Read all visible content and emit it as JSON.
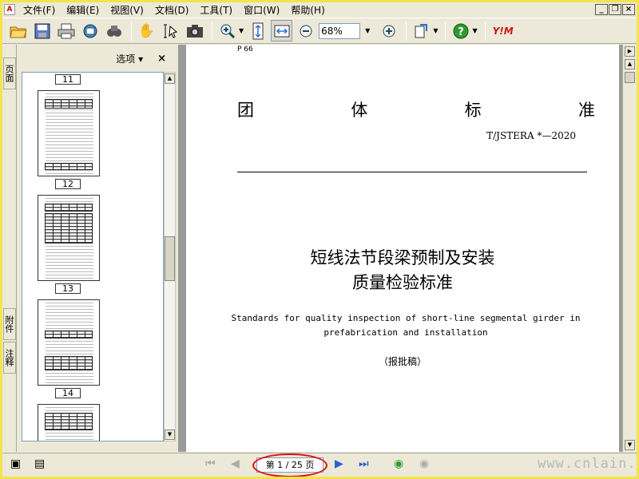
{
  "menubar": {
    "items": [
      "文件(F)",
      "编辑(E)",
      "视图(V)",
      "文档(D)",
      "工具(T)",
      "窗口(W)",
      "帮助(H)"
    ]
  },
  "toolbar": {
    "zoom_value": "68%",
    "brand": "Y!M",
    "icons": [
      "open-icon",
      "save-icon",
      "print-icon",
      "email-icon",
      "search-icon",
      "hand-tool-icon",
      "select-text-icon",
      "snapshot-icon",
      "zoom-in-icon",
      "fit-page-icon",
      "fit-width-icon",
      "zoom-out-icon",
      "zoom-plus-icon",
      "rotate-icon",
      "help-icon"
    ]
  },
  "side_tabs": {
    "pages": "页面",
    "attachments": "附件",
    "comments": "注释"
  },
  "nav_panel": {
    "options_label": "选项 ▾",
    "close_label": "×",
    "thumbnails": [
      "11",
      "12",
      "13",
      "14"
    ]
  },
  "document": {
    "page_ref": "P 66",
    "category_chars": [
      "团",
      "体",
      "标",
      "准"
    ],
    "standard_number": "T/JSTERA *—2020",
    "title_cn_line1": "短线法节段梁预制及安装",
    "title_cn_line2": "质量检验标准",
    "title_en_line1": "Standards for quality inspection of short-line segmental girder in",
    "title_en_line2": "prefabrication and installation",
    "status": "（报批稿）"
  },
  "bottom_bar": {
    "page_indicator": "第 1 / 25 页",
    "watermark": "www.cnlain.com"
  },
  "colors": {
    "frame": "#f2e44a",
    "annotation_oval": "#e01010"
  }
}
